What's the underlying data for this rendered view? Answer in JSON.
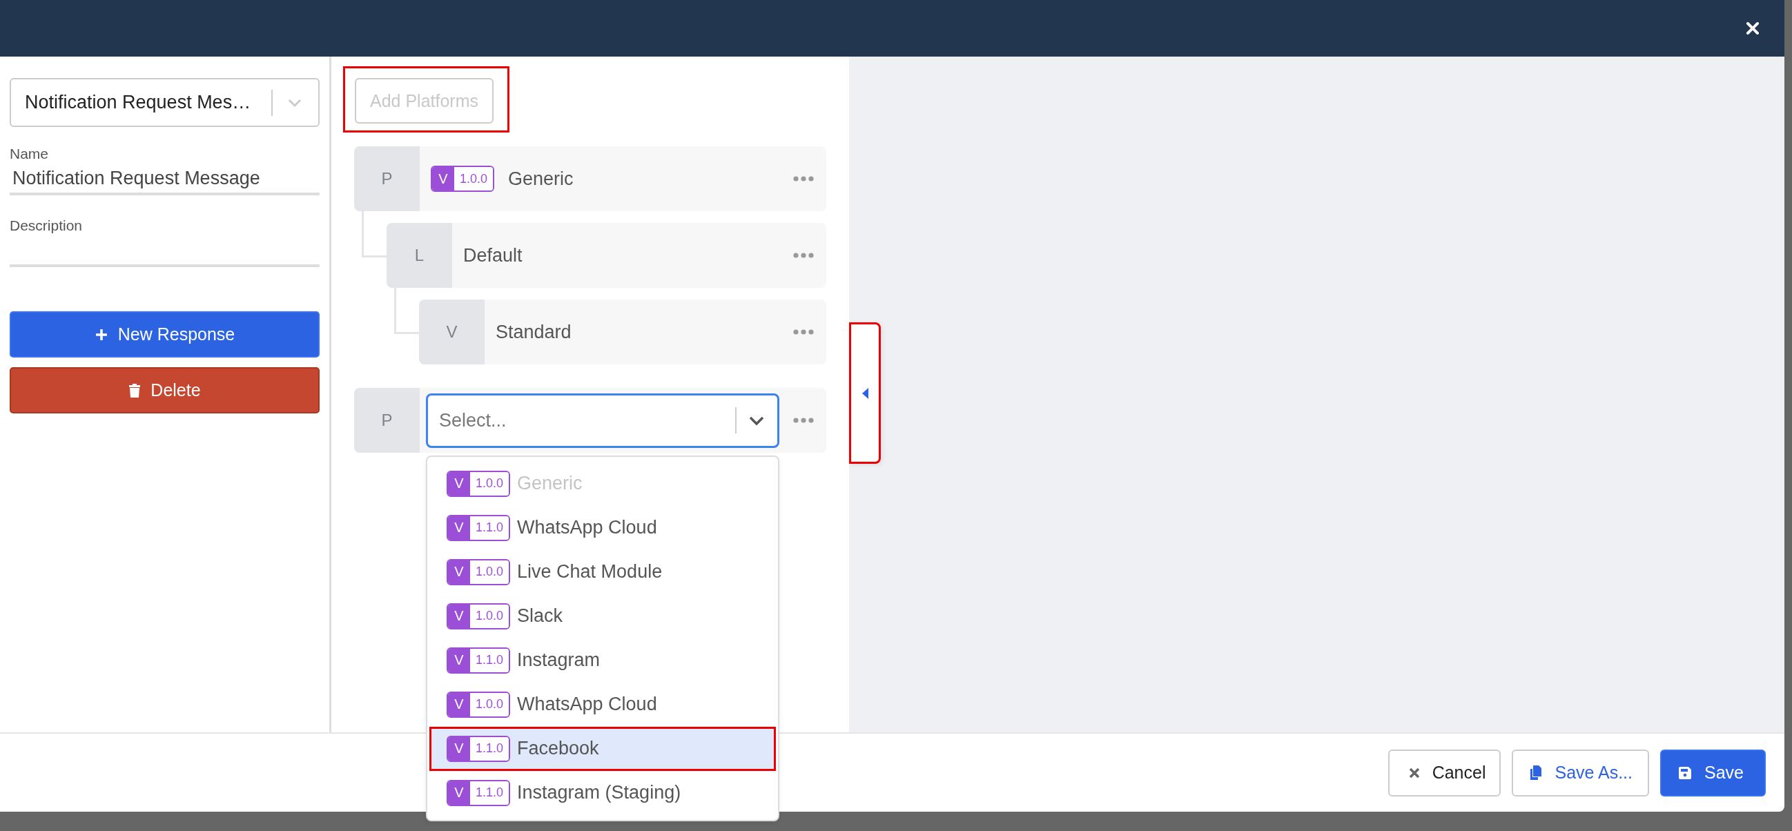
{
  "sidebar": {
    "response_select": {
      "value": "Notification Request Mes…"
    },
    "name_field": {
      "label": "Name",
      "value": "Notification Request Message"
    },
    "description_field": {
      "label": "Description"
    },
    "buttons": [
      {
        "kind": "primary",
        "label": "New Response"
      },
      {
        "kind": "danger",
        "label": "Delete"
      }
    ]
  },
  "platforms": {
    "add_button": {
      "label": "Add Platforms",
      "disabled": true,
      "highlighted": true
    },
    "tree": [
      {
        "letter": "P",
        "badge": {
          "letter": "V",
          "version": "1.0.0"
        },
        "label": "Generic",
        "children": [
          {
            "letter": "L",
            "label": "Default",
            "children": [
              {
                "letter": "V",
                "label": "Standard"
              }
            ]
          }
        ]
      }
    ],
    "new_platform": {
      "letter": "P",
      "select": {
        "placeholder": "Select..."
      },
      "options": [
        {
          "badge": {
            "letter": "V",
            "version": "1.0.0"
          },
          "label": "Generic",
          "disabled": true,
          "focused": false,
          "highlighted": false
        },
        {
          "badge": {
            "letter": "V",
            "version": "1.1.0"
          },
          "label": "WhatsApp Cloud",
          "disabled": false,
          "focused": false,
          "highlighted": false
        },
        {
          "badge": {
            "letter": "V",
            "version": "1.0.0"
          },
          "label": "Live Chat Module",
          "disabled": false,
          "focused": false,
          "highlighted": false
        },
        {
          "badge": {
            "letter": "V",
            "version": "1.0.0"
          },
          "label": "Slack",
          "disabled": false,
          "focused": false,
          "highlighted": false
        },
        {
          "badge": {
            "letter": "V",
            "version": "1.1.0"
          },
          "label": "Instagram",
          "disabled": false,
          "focused": false,
          "highlighted": false
        },
        {
          "badge": {
            "letter": "V",
            "version": "1.0.0"
          },
          "label": "WhatsApp Cloud",
          "disabled": false,
          "focused": false,
          "highlighted": false
        },
        {
          "badge": {
            "letter": "V",
            "version": "1.1.0"
          },
          "label": "Facebook",
          "disabled": false,
          "focused": true,
          "highlighted": true
        },
        {
          "badge": {
            "letter": "V",
            "version": "1.1.0"
          },
          "label": "Instagram (Staging)",
          "disabled": false,
          "focused": false,
          "highlighted": false
        }
      ]
    }
  },
  "side_toggle": {
    "highlighted": true
  },
  "footer": {
    "buttons": [
      {
        "kind": "cancel",
        "label": "Cancel"
      },
      {
        "kind": "save_as",
        "label": "Save As..."
      },
      {
        "kind": "save",
        "label": "Save"
      }
    ]
  }
}
